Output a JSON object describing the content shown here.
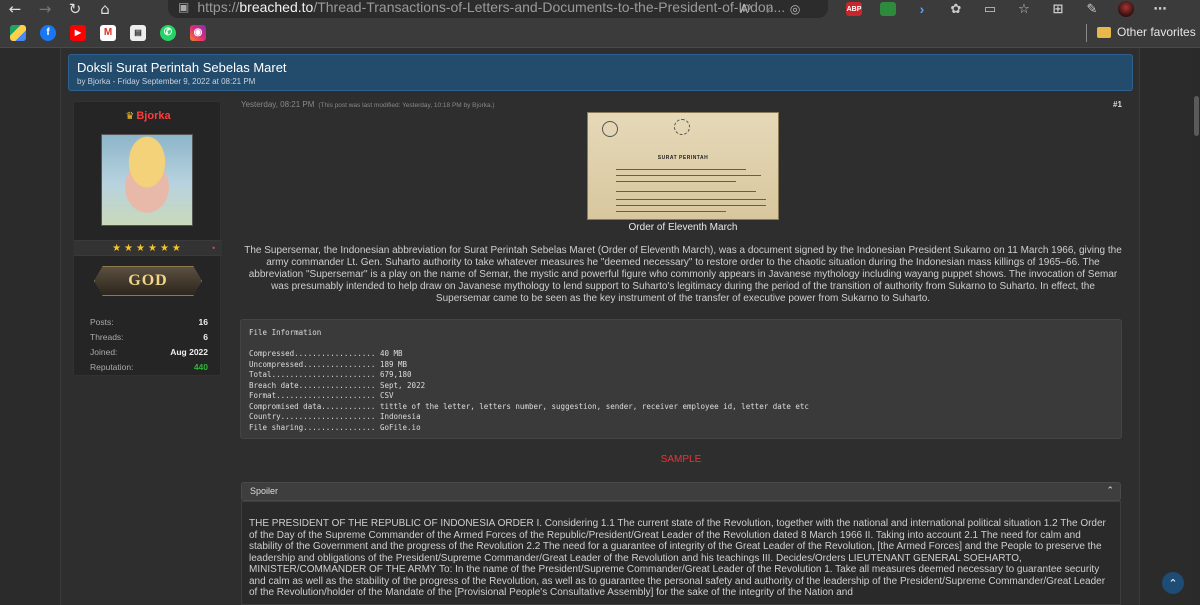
{
  "browser": {
    "url_prefix": "https://",
    "url_domain": "breached.to",
    "url_path": "/Thread-Transactions-of-Letters-and-Documents-to-the-President-of-Indon...",
    "read_aloud": "A⁾",
    "favorites_label": "Other favorites",
    "ext_abp": "ABP"
  },
  "thread": {
    "title": "Doksli Surat Perintah Sebelas Maret",
    "meta": "by Bjorka - Friday September 9, 2022 at 08:21 PM"
  },
  "user": {
    "name": "Bjorka",
    "stars": "★★★★★★",
    "rank_badge": "GOD",
    "stats": [
      {
        "label": "Posts:",
        "value": "16"
      },
      {
        "label": "Threads:",
        "value": "6"
      },
      {
        "label": "Joined:",
        "value": "Aug 2022"
      },
      {
        "label": "Reputation:",
        "value": "440"
      }
    ]
  },
  "post": {
    "time": "Yesterday, 08:21 PM",
    "modified": "(This post was last modified: Yesterday, 10:18 PM by Bjorka.)",
    "number": "#1",
    "image_caption": "Order of Eleventh March",
    "doc_title": "SURAT PERINTAH",
    "description": "The Supersemar, the Indonesian abbreviation for Surat Perintah Sebelas Maret (Order of Eleventh March), was a document signed by the Indonesian President Sukarno on 11 March 1966, giving the army commander Lt. Gen. Suharto authority to take whatever measures he \"deemed necessary\" to restore order to the chaotic situation during the Indonesian mass killings of 1965–66. The abbreviation \"Supersemar\" is a play on the name of Semar, the mystic and powerful figure who commonly appears in Javanese mythology including wayang puppet shows. The invocation of Semar was presumably intended to help draw on Javanese mythology to lend support to Suharto's legitimacy during the period of the transition of authority from Sukarno to Suharto. In effect, the Supersemar came to be seen as the key instrument of the transfer of executive power from Sukarno to Suharto.",
    "file_info": "File Information\n\nCompressed.................. 40 MB\nUncompressed................ 189 MB\nTotal....................... 679,180\nBreach date................. Sept, 2022\nFormat...................... CSV\nCompromised data............ tittle of the letter, letters number, suggestion, sender, receiver employee id, letter date etc\nCountry..................... Indonesia\nFile sharing................ GoFile.io",
    "sample_label": "SAMPLE",
    "spoiler_label": "Spoiler",
    "spoiler_text": "THE PRESIDENT OF THE REPUBLIC OF INDONESIA ORDER I. Considering 1.1 The current state of the Revolution, together with the national and international political situation 1.2 The Order of the Day of the Supreme Commander of the Armed Forces of the Republic/President/Great Leader of the Revolution dated 8 March 1966 II. Taking into account 2.1 The need for calm and stability of the Government and the progress of the Revolution 2.2 The need for a guarantee of integrity of the Great Leader of the Revolution, [the Armed Forces] and the People to preserve the leadership and obligations of the President/Supreme Commander/Great Leader of the Revolution and his teachings III. Decides/Orders LIEUTENANT GENERAL SOEHARTO, MINISTER/COMMANDER OF THE ARMY To: In the name of the President/Supreme Commander/Great Leader of the Revolution 1. Take all measures deemed necessary to guarantee security and calm as well as the stability of the progress of the Revolution, as well as to guarantee the personal safety and authority of the leadership of the President/Supreme Commander/Great Leader of the Revolution/holder of the Mandate of the [Provisional People's Consultative Assembly] for the sake of the integrity of the Nation and"
  }
}
